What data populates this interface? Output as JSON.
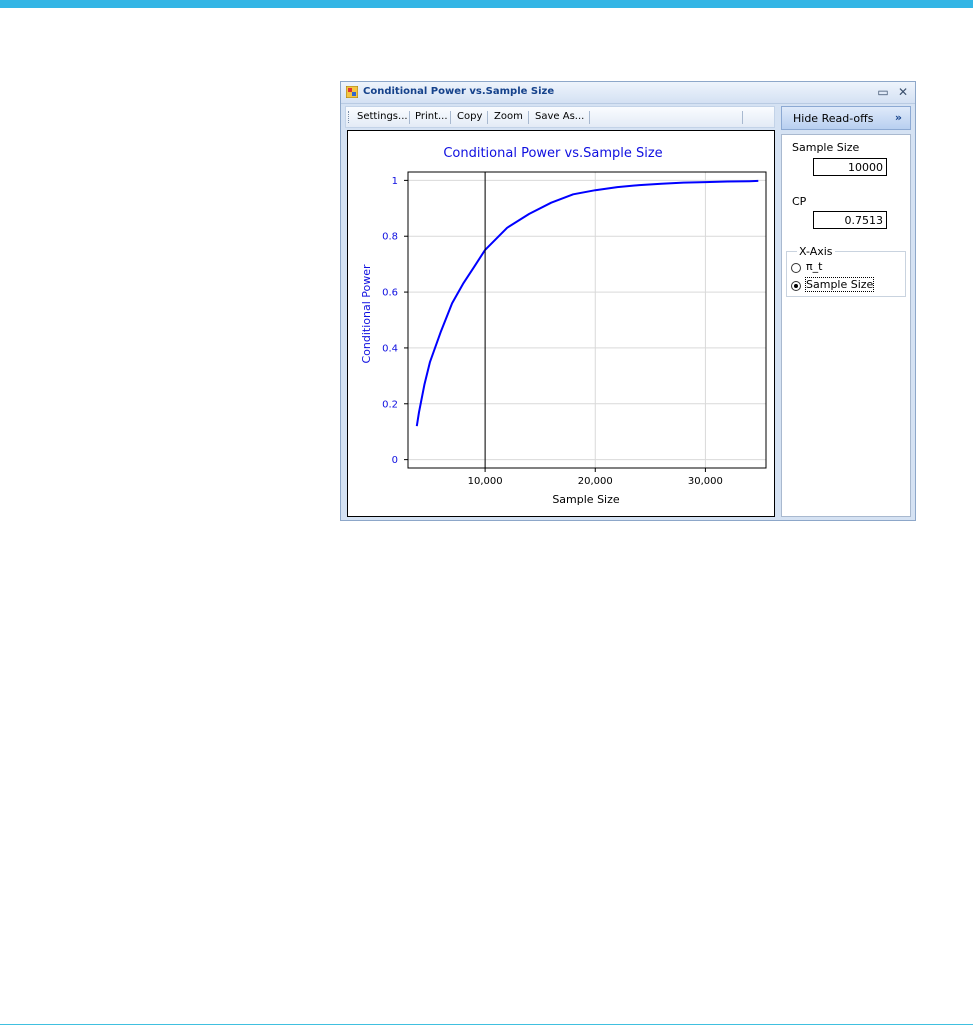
{
  "window": {
    "title": "Conditional Power vs.Sample Size",
    "restore_icon": "restore-icon",
    "close_icon": "close-icon"
  },
  "toolbar": {
    "items": [
      "Settings...",
      "Print...",
      "Copy",
      "Zoom",
      "Save As..."
    ]
  },
  "readoffs": {
    "hide_label": "Hide Read-offs",
    "hide_icon": "»",
    "sample_size_label": "Sample Size",
    "sample_size_value": "10000",
    "cp_label": "CP",
    "cp_value": "0.7513",
    "xaxis_group": "X-Axis",
    "options": [
      "π_t",
      "Sample Size"
    ],
    "selected_option": "Sample Size"
  },
  "colors": {
    "accent": "#33b5e5",
    "series": "#0000ff",
    "title_bar_text": "#15428b"
  },
  "chart_data": {
    "type": "line",
    "title": "Conditional Power vs.Sample Size",
    "xlabel": "Sample Size",
    "ylabel": "Conditional Power",
    "xlim": [
      3000,
      35500
    ],
    "ylim": [
      -0.03,
      1.03
    ],
    "xticks": [
      10000,
      20000,
      30000
    ],
    "xtick_labels": [
      "10,000",
      "20,000",
      "30,000"
    ],
    "yticks": [
      0,
      0.2,
      0.4,
      0.6,
      0.8,
      1
    ],
    "ytick_labels": [
      "0",
      "0.2",
      "0.4",
      "0.6",
      "0.8",
      "1"
    ],
    "grid": true,
    "readoff_x": 10000,
    "series": [
      {
        "x": [
          3800,
          4000,
          4500,
          5000,
          6000,
          7000,
          8000,
          9000,
          10000,
          12000,
          14000,
          16000,
          18000,
          20000,
          22000,
          24000,
          26000,
          28000,
          30000,
          32000,
          34000,
          34800
        ],
        "y": [
          0.12,
          0.17,
          0.27,
          0.35,
          0.46,
          0.56,
          0.63,
          0.69,
          0.751,
          0.83,
          0.88,
          0.92,
          0.95,
          0.965,
          0.976,
          0.983,
          0.988,
          0.992,
          0.994,
          0.996,
          0.997,
          0.998
        ]
      }
    ]
  }
}
